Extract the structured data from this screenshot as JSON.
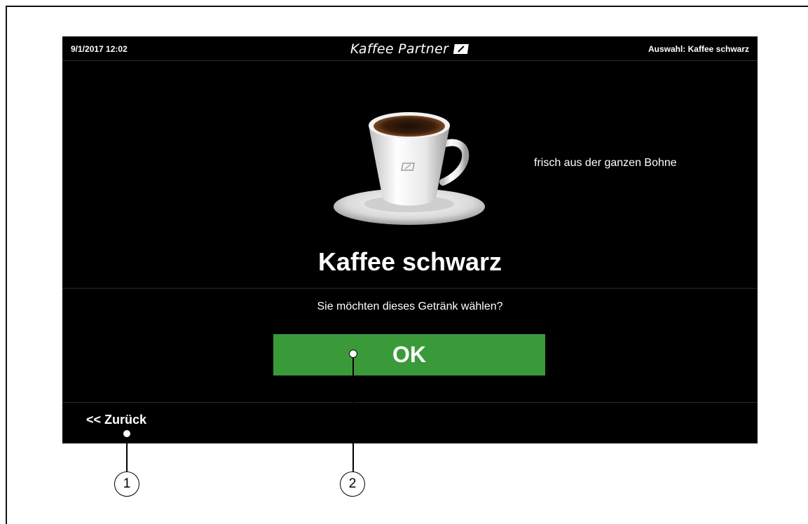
{
  "header": {
    "datetime": "9/1/2017 12:02",
    "brand": "Kaffee Partner",
    "selection": "Auswahl: Kaffee schwarz"
  },
  "product": {
    "name": "Kaffee schwarz",
    "tagline": "frisch aus der ganzen Bohne",
    "image_icon": "coffee-cup-icon"
  },
  "prompt": {
    "question": "Sie möchten dieses Getränk wählen?",
    "ok_label": "OK"
  },
  "footer": {
    "back_label": "<< Zurück"
  },
  "callouts": [
    {
      "number": "1",
      "target": "back-link"
    },
    {
      "number": "2",
      "target": "ok-button"
    }
  ],
  "colors": {
    "screen_background": "#000000",
    "ok_button": "#3a9a3a",
    "text": "#ffffff"
  }
}
